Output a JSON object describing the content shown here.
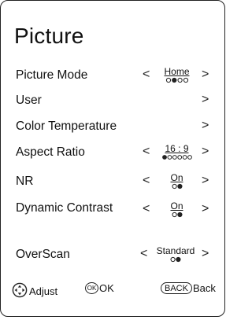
{
  "title": "Picture",
  "rows": [
    {
      "label": "Picture Mode",
      "value": "Home",
      "dots": 4,
      "active_dot": 2,
      "has_left": true,
      "has_right": true
    },
    {
      "label": "User",
      "has_left": false,
      "has_right": true
    },
    {
      "label": "Color Temperature",
      "has_left": false,
      "has_right": true
    },
    {
      "label": "Aspect Ratio",
      "value": "16 : 9",
      "dots": 6,
      "active_dot": 1,
      "has_left": true,
      "has_right": true
    },
    {
      "label": "NR",
      "value": "On",
      "dots": 2,
      "active_dot": 1,
      "has_left": true,
      "has_right": true
    },
    {
      "label": "Dynamic Contrast",
      "value": "On",
      "dots": 2,
      "active_dot": 1,
      "has_left": true,
      "has_right": true
    },
    {
      "label": "OverScan",
      "value": "Standard",
      "dots": 2,
      "active_dot": 1,
      "has_left": true,
      "has_right": true
    }
  ],
  "arrows": {
    "left": "<",
    "right": ">"
  },
  "footer": {
    "adjust_label": "Adjust",
    "ok_badge": "OK",
    "ok_label": "OK",
    "back_badge": "BACK",
    "back_label": "Back"
  },
  "icons": {
    "adjust": "dpad-icon",
    "ok": "ok-button-icon",
    "back": "back-button-icon"
  }
}
